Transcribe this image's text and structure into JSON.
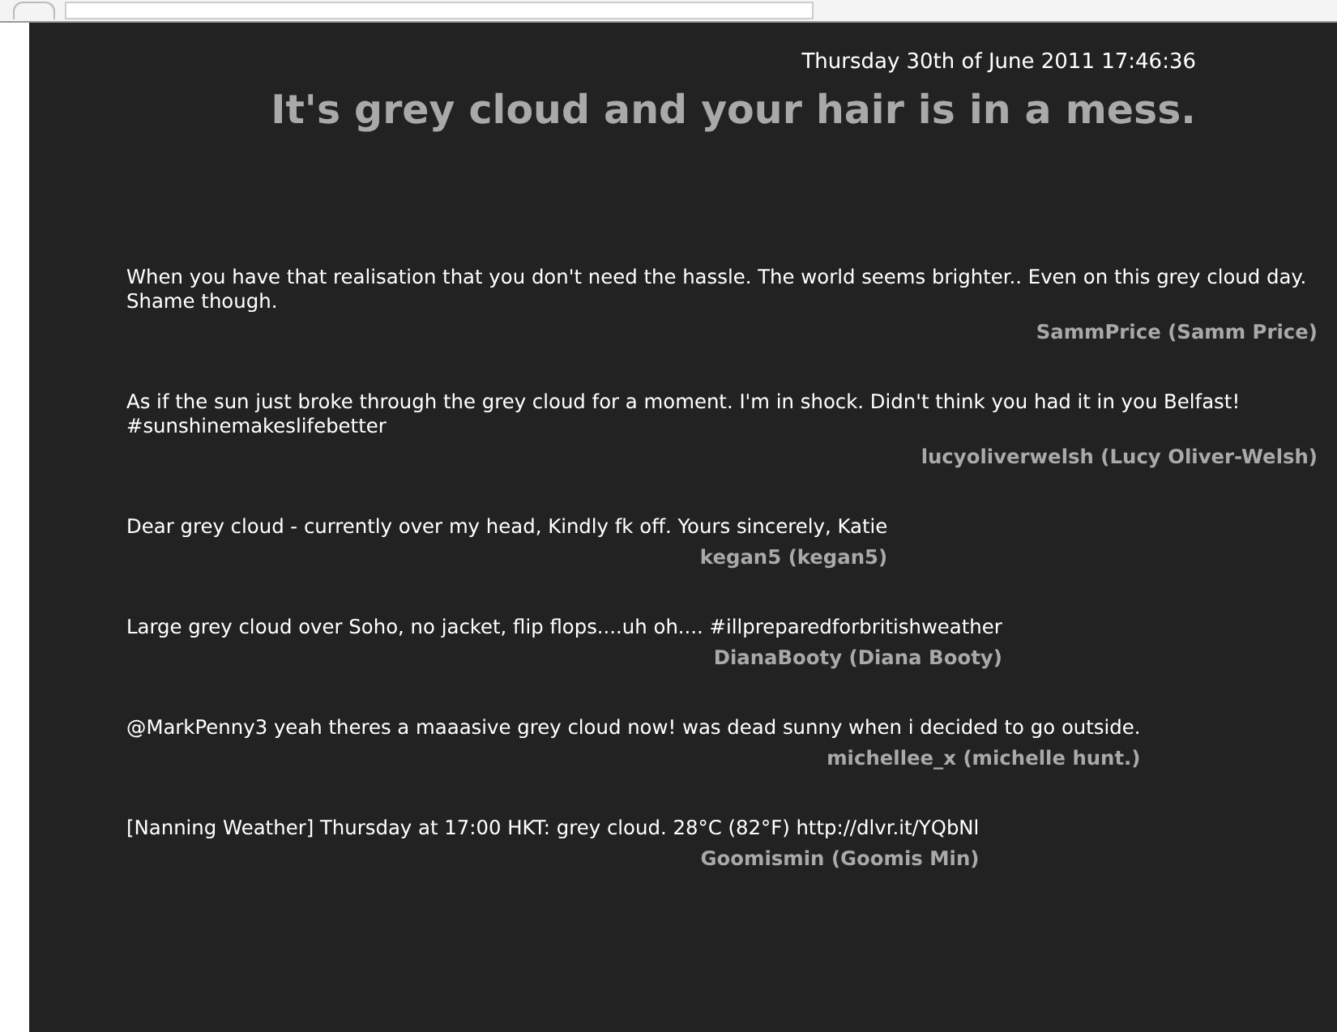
{
  "date": "Thursday 30th of June 2011 17:46:36",
  "headline": "It's grey cloud and your hair is in a mess.",
  "tweets": [
    {
      "text": "When you have that realisation that you don't need the hassle. The world seems brighter.. Even on this grey cloud day. Shame though.",
      "author": "SammPrice (Samm Price)"
    },
    {
      "text": "As if the sun just broke through the grey cloud for a moment. I'm in shock. Didn't think you had it in you Belfast! #sunshinemakeslifebetter",
      "author": "lucyoliverwelsh (Lucy Oliver-Welsh)"
    },
    {
      "text": "Dear grey cloud - currently over my head, Kindly fk off. Yours sincerely, Katie",
      "author": "kegan5 (kegan5)"
    },
    {
      "text": "Large grey cloud over Soho, no jacket, flip flops....uh oh.... #illpreparedforbritishweather",
      "author": "DianaBooty (Diana Booty)"
    },
    {
      "text": "@MarkPenny3 yeah theres a maaasive grey cloud now! was dead sunny when i decided to go outside.",
      "author": "michellee_x (michelle hunt.)"
    },
    {
      "text": "[Nanning Weather] Thursday at 17:00 HKT: grey cloud. 28°C (82°F) http://dlvr.it/YQbNl",
      "author": "Goomismin (Goomis Min)"
    }
  ]
}
